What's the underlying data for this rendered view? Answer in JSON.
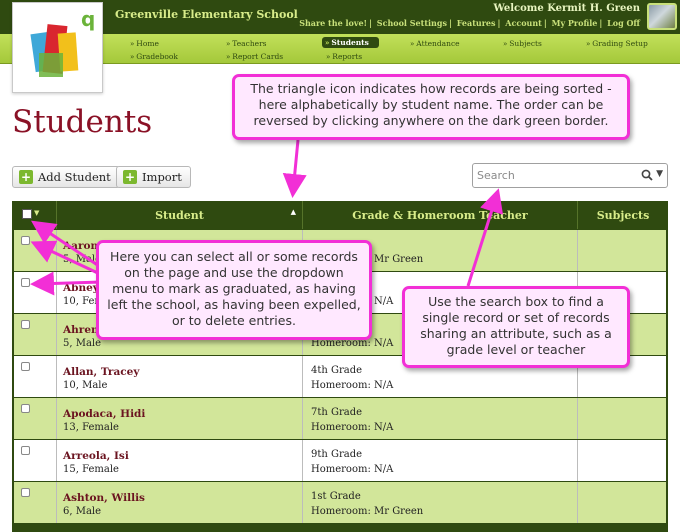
{
  "header": {
    "school_name": "Greenville Elementary School",
    "welcome": "Welcome Kermit H. Green",
    "links": [
      "Share the love!",
      "School Settings",
      "Features",
      "Account",
      "My Profile",
      "Log Off"
    ],
    "logo_letter": "q"
  },
  "nav": {
    "home": "Home",
    "gradebook": "Gradebook",
    "teachers": "Teachers",
    "report_cards": "Report Cards",
    "students": "Students",
    "reports": "Reports",
    "attendance": "Attendance",
    "subjects": "Subjects",
    "grading_setup": "Grading Setup",
    "active": "Students"
  },
  "page": {
    "title": "Students"
  },
  "toolbar": {
    "add_student": "Add Student",
    "import": "Import"
  },
  "search": {
    "placeholder": "Search"
  },
  "table": {
    "columns": [
      "Student",
      "Grade & Homeroom Teacher",
      "Subjects"
    ],
    "rows": [
      {
        "name": "Aaron",
        "info": "5, Male",
        "grade": "",
        "homeroom": "Homeroom: Mr Green"
      },
      {
        "name": "Abney",
        "info": "10, Female",
        "grade": "",
        "homeroom": "Homeroom: N/A"
      },
      {
        "name": "Ahrens",
        "info": "5, Male",
        "grade": "",
        "homeroom": "Homeroom: N/A"
      },
      {
        "name": "Allan, Tracey",
        "info": "10, Male",
        "grade": "4th Grade",
        "homeroom": "Homeroom: N/A"
      },
      {
        "name": "Apodaca, Hidi",
        "info": "13, Female",
        "grade": "7th Grade",
        "homeroom": "Homeroom: N/A"
      },
      {
        "name": "Arreola, Isi",
        "info": "15, Female",
        "grade": "9th Grade",
        "homeroom": "Homeroom: N/A"
      },
      {
        "name": "Ashton, Willis",
        "info": "6, Male",
        "grade": "1st Grade",
        "homeroom": "Homeroom: Mr Green"
      }
    ]
  },
  "callouts": {
    "sort": "The triangle icon indicates how records are being sorted - here alphabetically by student name. The order can be reversed by clicking anywhere on the dark green border.",
    "select": "Here you can select all or some records on the page and use the dropdown menu to mark as graduated, as having left the school, as having been expelled, or to delete entries.",
    "search": "Use the search box to find a single record or set of records sharing an attribute, such as a grade level or teacher"
  },
  "colors": {
    "dark_green": "#2f4a10",
    "light_green": "#c2e05a",
    "row_green": "#d2e69a",
    "title_red": "#8a1126",
    "callout_border": "#f22fd6",
    "callout_fill": "#ffe8ff"
  },
  "icons": [
    "plus-icon",
    "search-icon",
    "chevron-down-icon",
    "sort-triangle-icon",
    "checkbox-icon"
  ]
}
